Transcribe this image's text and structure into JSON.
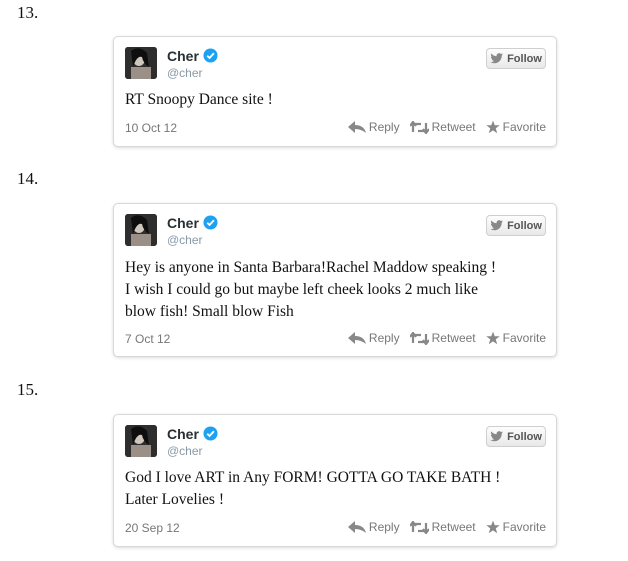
{
  "tweets": [
    {
      "number": "13.",
      "name": "Cher",
      "handle": "@cher",
      "follow_label": "Follow",
      "text": "RT Snoopy Dance site !",
      "date": "10 Oct 12",
      "reply_label": "Reply",
      "retweet_label": "Retweet",
      "favorite_label": "Favorite"
    },
    {
      "number": "14.",
      "name": "Cher",
      "handle": "@cher",
      "follow_label": "Follow",
      "text": "Hey is anyone in Santa Barbara!Rachel Maddow speaking !\nI wish I could go but maybe left cheek looks 2 much like\nblow fish! Small blow Fish",
      "date": "7 Oct 12",
      "reply_label": "Reply",
      "retweet_label": "Retweet",
      "favorite_label": "Favorite"
    },
    {
      "number": "15.",
      "name": "Cher",
      "handle": "@cher",
      "follow_label": "Follow",
      "text": "God I love ART in Any FORM! GOTTA GO TAKE BATH !\nLater Lovelies !",
      "date": "20 Sep 12",
      "reply_label": "Reply",
      "retweet_label": "Retweet",
      "favorite_label": "Favorite"
    }
  ],
  "colors": {
    "verified": "#1da1f2",
    "icon_gray": "#888888"
  }
}
